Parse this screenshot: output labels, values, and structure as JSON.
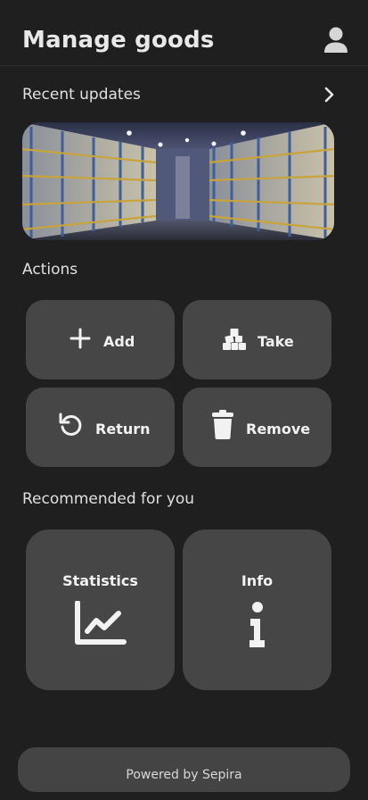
{
  "header": {
    "title": "Manage goods",
    "profile_icon": "user-icon"
  },
  "recent_updates": {
    "title": "Recent updates",
    "chevron_icon": "chevron-right-icon"
  },
  "actions": {
    "title": "Actions",
    "items": [
      {
        "label": "Add",
        "icon": "plus-icon"
      },
      {
        "label": "Take",
        "icon": "boxes-icon"
      },
      {
        "label": "Return",
        "icon": "undo-icon"
      },
      {
        "label": "Remove",
        "icon": "trash-icon"
      }
    ]
  },
  "recommended": {
    "title": "Recommended for you",
    "items": [
      {
        "label": "Statistics",
        "icon": "chart-line-icon"
      },
      {
        "label": "Info",
        "icon": "info-icon"
      }
    ]
  },
  "footer": {
    "text": "Powered by Sepira"
  },
  "colors": {
    "background": "#1f1f1f",
    "tile": "#464646",
    "footer": "#444444",
    "text": "#e6e6e6"
  }
}
